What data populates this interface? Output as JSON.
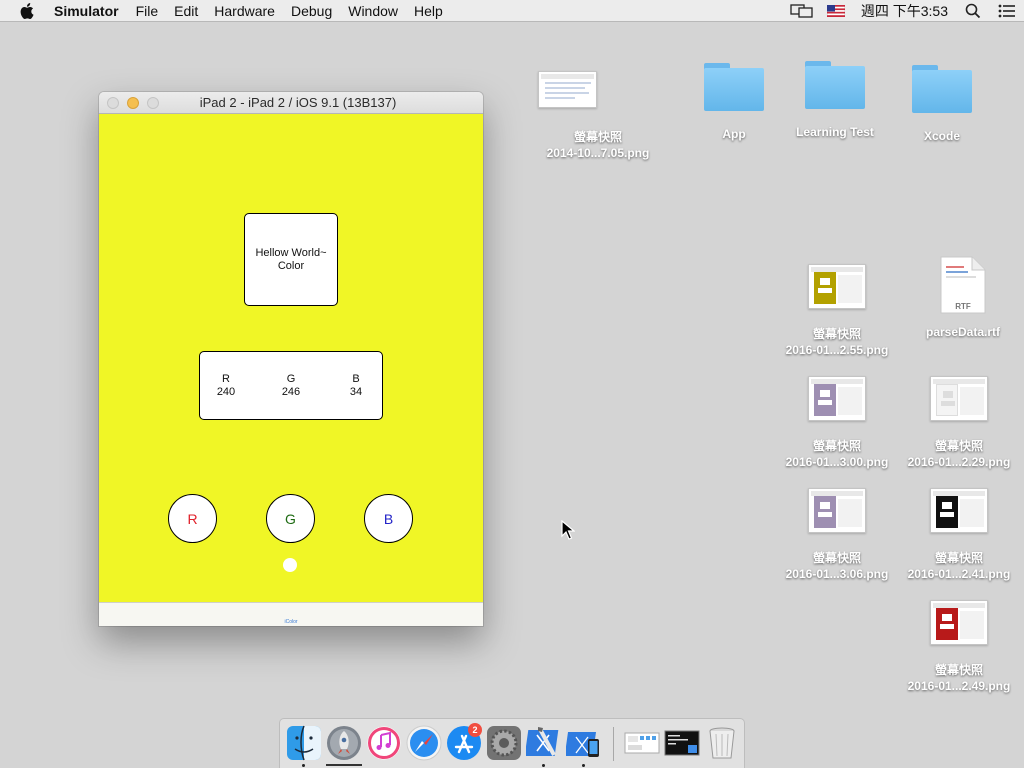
{
  "menubar": {
    "app_name": "Simulator",
    "menus": [
      "File",
      "Edit",
      "Hardware",
      "Debug",
      "Window",
      "Help"
    ],
    "clock": "週四 下午3:53",
    "status_icons": [
      "display-mirroring-icon",
      "us-flag-input-icon",
      "spotlight-search-icon",
      "notification-center-icon"
    ]
  },
  "simulator": {
    "title": "iPad 2 - iPad 2 / iOS 9.1 (13B137)",
    "background_color": "#f0f626",
    "hello_line1": "Hellow World~",
    "hello_line2": "Color",
    "r_label": "R",
    "r_value": "240",
    "g_label": "G",
    "g_value": "246",
    "b_label": "B",
    "b_value": "34",
    "buttons": {
      "r": "R",
      "g": "G",
      "b": "B"
    },
    "button_colors": {
      "r": "#e0202a",
      "g": "#1d6a12",
      "b": "#2424c8"
    },
    "tab_label": "iColor"
  },
  "desktop": {
    "top_screenshot": {
      "line1": "螢幕快照",
      "line2": "2014-10...7.05.png"
    },
    "folders": {
      "app": "App",
      "learning_test": "Learning Test",
      "xcode": "Xcode"
    },
    "files": {
      "s1": {
        "line1": "螢幕快照",
        "line2": "2016-01...2.55.png",
        "thumb_color": "#b3a100"
      },
      "rtf": {
        "name": "parseData.rtf",
        "ext": "RTF"
      },
      "s2": {
        "line1": "螢幕快照",
        "line2": "2016-01...3.00.png",
        "thumb_color": "#9e8fb2"
      },
      "s3": {
        "line1": "螢幕快照",
        "line2": "2016-01...2.29.png",
        "thumb_color": "#f4f4f4"
      },
      "s4": {
        "line1": "螢幕快照",
        "line2": "2016-01...3.06.png",
        "thumb_color": "#9e8fb2"
      },
      "s5": {
        "line1": "螢幕快照",
        "line2": "2016-01...2.41.png",
        "thumb_color": "#111111"
      },
      "s6": {
        "line1": "螢幕快照",
        "line2": "2016-01...2.49.png",
        "thumb_color": "#b81a1a"
      }
    }
  },
  "dock": {
    "apps": [
      "finder",
      "launchpad",
      "itunes",
      "safari",
      "app-store",
      "system-preferences",
      "xcode",
      "simulator",
      "desktop-preview",
      "terminal",
      "trash"
    ],
    "app_store_badge": "2"
  }
}
